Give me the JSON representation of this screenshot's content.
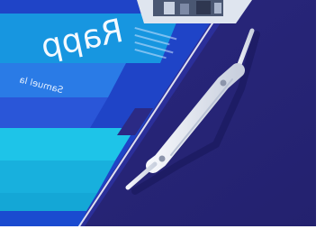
{
  "photo": {
    "cover_title_fragment": "Rapp",
    "cover_subtitle_fragment": "Samuel la",
    "text_appears_mirrored": true,
    "colors": {
      "folder_navy": "#29277a",
      "cover_blue": "#1b4fd1",
      "cover_cyan": "#16b3e0",
      "fastener_white": "#e8ecf3",
      "border_white": "#ffffff"
    },
    "objects": [
      "blue-report-cover",
      "navy-folder-background",
      "white-plastic-binding-fastener",
      "partial-inset-photo"
    ]
  }
}
